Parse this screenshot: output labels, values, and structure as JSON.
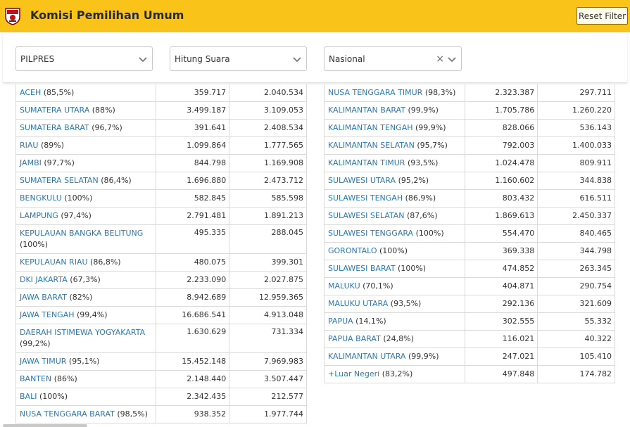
{
  "header": {
    "title": "Komisi Pemilihan Umum",
    "reset_label": "Reset Filter",
    "colors": {
      "bar": "#f9c31a",
      "link": "#2a79b7"
    }
  },
  "filters": {
    "election": {
      "value": "PILPRES"
    },
    "mode": {
      "value": "Hitung Suara"
    },
    "region": {
      "value": "Nasional"
    }
  },
  "icons": {
    "logo": "kpu-logo-icon",
    "dropdown": "chevron-down-icon",
    "clear": "close-icon"
  },
  "left_table": [
    {
      "province": "ACEH",
      "pct": "(85,5%)",
      "a": "359.717",
      "b": "2.040.534"
    },
    {
      "province": "SUMATERA UTARA",
      "pct": "(88%)",
      "a": "3.499.187",
      "b": "3.109.053"
    },
    {
      "province": "SUMATERA BARAT",
      "pct": "(96,7%)",
      "a": "391.641",
      "b": "2.408.534"
    },
    {
      "province": "RIAU",
      "pct": "(89%)",
      "a": "1.099.864",
      "b": "1.777.565"
    },
    {
      "province": "JAMBI",
      "pct": "(97,7%)",
      "a": "844.798",
      "b": "1.169.908"
    },
    {
      "province": "SUMATERA SELATAN",
      "pct": "(86,4%)",
      "a": "1.696.880",
      "b": "2.473.712"
    },
    {
      "province": "BENGKULU",
      "pct": "(100%)",
      "a": "582.845",
      "b": "585.598"
    },
    {
      "province": "LAMPUNG",
      "pct": "(97,4%)",
      "a": "2.791.481",
      "b": "1.891.213"
    },
    {
      "province": "KEPULAUAN BANGKA BELITUNG",
      "pct": "(100%)",
      "a": "495.335",
      "b": "288.045"
    },
    {
      "province": "KEPULAUAN RIAU",
      "pct": "(86,8%)",
      "a": "480.075",
      "b": "399.301"
    },
    {
      "province": "DKI JAKARTA",
      "pct": "(67,3%)",
      "a": "2.233.090",
      "b": "2.027.875"
    },
    {
      "province": "JAWA BARAT",
      "pct": "(82%)",
      "a": "8.942.689",
      "b": "12.959.365"
    },
    {
      "province": "JAWA TENGAH",
      "pct": "(99,4%)",
      "a": "16.686.541",
      "b": "4.913.048"
    },
    {
      "province": "DAERAH ISTIMEWA YOGYAKARTA",
      "pct": "(99,2%)",
      "a": "1.630.629",
      "b": "731.334"
    },
    {
      "province": "JAWA TIMUR",
      "pct": "(95,1%)",
      "a": "15.452.148",
      "b": "7.969.983"
    },
    {
      "province": "BANTEN",
      "pct": "(86%)",
      "a": "2.148.440",
      "b": "3.507.447"
    },
    {
      "province": "BALI",
      "pct": "(100%)",
      "a": "2.342.435",
      "b": "212.577"
    },
    {
      "province": "NUSA TENGGARA BARAT",
      "pct": "(98,5%)",
      "a": "938.352",
      "b": "1.977.744"
    }
  ],
  "right_table": [
    {
      "province": "NUSA TENGGARA TIMUR",
      "pct": "(98,3%)",
      "a": "2.323.387",
      "b": "297.711"
    },
    {
      "province": "KALIMANTAN BARAT",
      "pct": "(99,9%)",
      "a": "1.705.786",
      "b": "1.260.220"
    },
    {
      "province": "KALIMANTAN TENGAH",
      "pct": "(99,9%)",
      "a": "828.066",
      "b": "536.143"
    },
    {
      "province": "KALIMANTAN SELATAN",
      "pct": "(95,7%)",
      "a": "792.003",
      "b": "1.400.033"
    },
    {
      "province": "KALIMANTAN TIMUR",
      "pct": "(93,5%)",
      "a": "1.024.478",
      "b": "809.911"
    },
    {
      "province": "SULAWESI UTARA",
      "pct": "(95,2%)",
      "a": "1.160.602",
      "b": "344.838"
    },
    {
      "province": "SULAWESI TENGAH",
      "pct": "(86,9%)",
      "a": "803.432",
      "b": "616.511"
    },
    {
      "province": "SULAWESI SELATAN",
      "pct": "(87,6%)",
      "a": "1.869.613",
      "b": "2.450.337"
    },
    {
      "province": "SULAWESI TENGGARA",
      "pct": "(100%)",
      "a": "554.470",
      "b": "840.465"
    },
    {
      "province": "GORONTALO",
      "pct": "(100%)",
      "a": "369.338",
      "b": "344.798"
    },
    {
      "province": "SULAWESI BARAT",
      "pct": "(100%)",
      "a": "474.852",
      "b": "263.345"
    },
    {
      "province": "MALUKU",
      "pct": "(70,1%)",
      "a": "404.871",
      "b": "290.754"
    },
    {
      "province": "MALUKU UTARA",
      "pct": "(93,5%)",
      "a": "292.136",
      "b": "321.609"
    },
    {
      "province": "PAPUA",
      "pct": "(14,1%)",
      "a": "302.555",
      "b": "55.332"
    },
    {
      "province": "PAPUA BARAT",
      "pct": "(24,8%)",
      "a": "116.021",
      "b": "40.322"
    },
    {
      "province": "KALIMANTAN UTARA",
      "pct": "(99,9%)",
      "a": "247.021",
      "b": "105.410"
    },
    {
      "province": "+Luar Negeri",
      "pct": "(83,2%)",
      "a": "497.848",
      "b": "174.782"
    }
  ]
}
